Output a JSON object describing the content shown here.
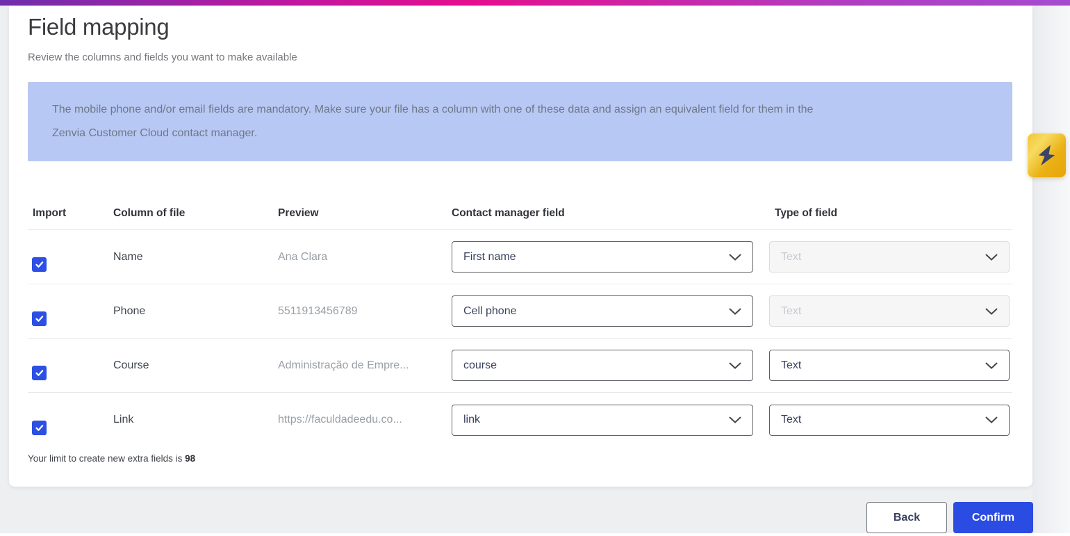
{
  "page": {
    "title": "Field mapping",
    "subtitle": "Review the columns and fields you want to make available"
  },
  "banner": {
    "line1": "The mobile phone and/or email fields are mandatory. Make sure your file has a column with one of these data and assign an equivalent field for them in the",
    "line2": "Zenvia Customer Cloud contact manager.",
    "bg_color": "#b8c8f4"
  },
  "quick_action": {
    "icon": "lightning-bolt-icon",
    "bg_color": "#eab114",
    "bolt_color": "#3d4566"
  },
  "table": {
    "headers": [
      "Import",
      "Column of file",
      "Preview",
      "Contact manager field",
      "Type of field"
    ],
    "rows": [
      {
        "import_checked": true,
        "column": "Name",
        "preview": "Ana Clara",
        "field": "First name",
        "type": "Text",
        "type_disabled": true
      },
      {
        "import_checked": true,
        "column": "Phone",
        "preview": "5511913456789",
        "field": "Cell phone",
        "type": "Text",
        "type_disabled": true
      },
      {
        "import_checked": true,
        "column": "Course",
        "preview": "Administração de Empre...",
        "field": "course",
        "type": "Text",
        "type_disabled": false
      },
      {
        "import_checked": true,
        "column": "Link",
        "preview": "https://faculdadeedu.co...",
        "field": "link",
        "type": "Text",
        "type_disabled": false
      }
    ]
  },
  "footer": {
    "limit_prefix": "Your limit to create new extra fields is ",
    "limit_value": "98"
  },
  "actions": {
    "back_label": "Back",
    "confirm_label": "Confirm"
  },
  "colors": {
    "accent_blue": "#2c4fe4",
    "confirm_bg": "#2b4ce2",
    "gradient_left": "#6e2fad",
    "gradient_mid": "#e50f8d",
    "gradient_right": "#a54bd1",
    "banner_bg": "#b8c8f4"
  }
}
